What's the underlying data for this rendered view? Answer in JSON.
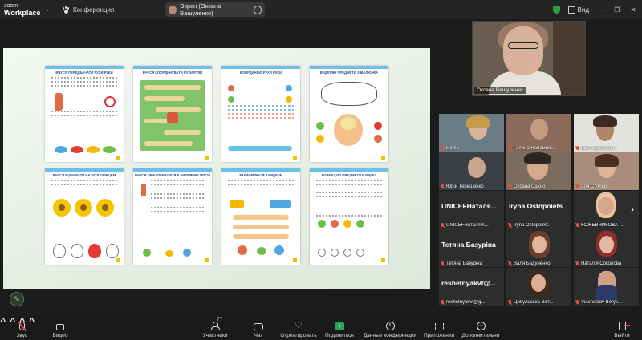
{
  "app": {
    "brand_line1": "zoom",
    "brand_line2": "Workplace",
    "meeting_title": "Конференция",
    "screen_share_label": "Экран (Оксана Вашуленко)",
    "view_label": "Вид"
  },
  "worksheets": [
    {
      "title": "ВЧУСЯ ПЕРЕДБАЧАТИ РУХИ РУКИ"
    },
    {
      "title": "ВЧУСЯ КООРДИНУВАТИ РУХИ РУКИ"
    },
    {
      "title": "КООРДИНУЮ РУХИ РУКИ"
    },
    {
      "title": "ВИДІЛЯЮ ПРЕДМЕТИ З МАЛЮНКА"
    },
    {
      "title": "ВЧУСЯ ВІДЧУВАТИ НАТИСК ОЛІВЦЕМ"
    },
    {
      "title": "ВЧУСЯ ОРІЄНТУВАТИСЯ В НАПРЯМКУ ПИСЬМА"
    },
    {
      "title": "ЗНАЙОМЛЮСЯ З РЯДКОМ"
    },
    {
      "title": "РОЗМІЩУЮ ПРЕДМЕТИ В РЯДКУ"
    }
  ],
  "speaker": {
    "name": "Оксана Вашуленко"
  },
  "participants": [
    {
      "name": "Home",
      "big": ""
    },
    {
      "name": "Галина Непомня...",
      "big": ""
    },
    {
      "name": "Ірина Данільче...",
      "big": ""
    },
    {
      "name": "Юрій Терещенко",
      "big": ""
    },
    {
      "name": "Оксана Сахно",
      "big": ""
    },
    {
      "name": "Зоя Столяр",
      "big": ""
    },
    {
      "name": "UNICEFНаталя К...",
      "big": "UNICEFНаталя..."
    },
    {
      "name": "Iryna Ostopolets",
      "big": "Iryna Ostopolets"
    },
    {
      "name": "КОЖЕВНИКОВА ...",
      "big": ""
    },
    {
      "name": "Тетяна Базурiна",
      "big": "Тетяна Базурiна"
    },
    {
      "name": "Валя Бадуненко",
      "big": ""
    },
    {
      "name": "Наталiя Соколова",
      "big": ""
    },
    {
      "name": "reshetnyakvf@g...",
      "big": "reshetnyakvf@..."
    },
    {
      "name": "Цибульська Вікт...",
      "big": ""
    },
    {
      "name": "Viacheslav Borys...",
      "big": ""
    }
  ],
  "toolbar": {
    "audio": "Звук",
    "video": "Видео",
    "participants": "Участники",
    "participants_count": "77",
    "chat": "Чат",
    "react": "Отреагировать",
    "share": "Поделиться",
    "info": "Данные конференции",
    "apps": "Приложения",
    "more": "Дополнительно",
    "leave": "Выйти"
  },
  "colors": {
    "accent_green": "#27a35a",
    "muted_red": "#e34d4d"
  }
}
